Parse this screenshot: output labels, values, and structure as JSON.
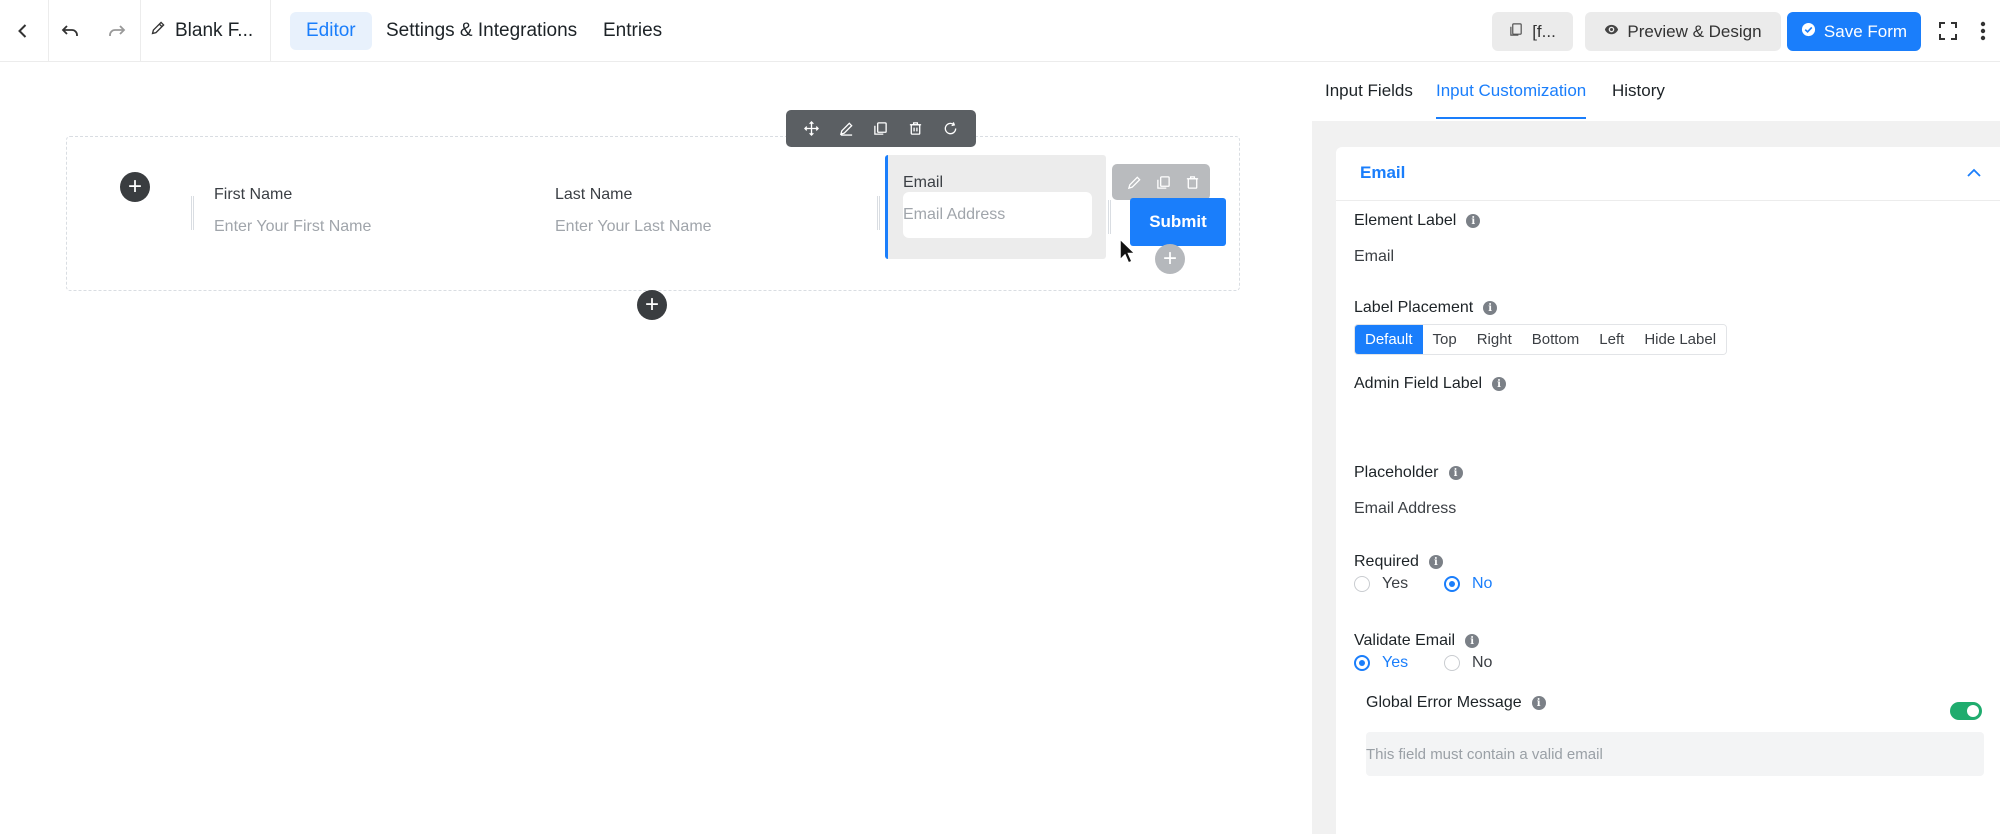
{
  "topbar": {
    "form_name": "Blank F...",
    "tabs": [
      "Editor",
      "Settings & Integrations",
      "Entries"
    ],
    "shortcode_label": "[f...",
    "preview_label": "Preview & Design",
    "save_label": "Save Form"
  },
  "canvas": {
    "fields": {
      "first_name_label": "First Name",
      "first_name_placeholder": "Enter Your First Name",
      "last_name_label": "Last Name",
      "last_name_placeholder": "Enter Your Last Name",
      "email_label": "Email",
      "email_placeholder": "Email Address"
    },
    "submit_label": "Submit"
  },
  "panel": {
    "tabs": [
      "Input Fields",
      "Input Customization",
      "History"
    ],
    "active_tab": "Input Customization",
    "section_title": "Email",
    "element_label": {
      "label": "Element Label",
      "value": "Email"
    },
    "label_placement": {
      "label": "Label Placement",
      "options": [
        "Default",
        "Top",
        "Right",
        "Bottom",
        "Left",
        "Hide Label"
      ],
      "selected": "Default"
    },
    "admin_field_label": {
      "label": "Admin Field Label",
      "value": ""
    },
    "placeholder": {
      "label": "Placeholder",
      "value": "Email Address"
    },
    "required": {
      "label": "Required",
      "options": [
        "Yes",
        "No"
      ],
      "selected": "No"
    },
    "validate_email": {
      "label": "Validate Email",
      "options": [
        "Yes",
        "No"
      ],
      "selected": "Yes"
    },
    "global_error": {
      "label": "Global Error Message",
      "enabled": true,
      "value": "This field must contain a valid email"
    }
  },
  "colors": {
    "accent": "#1a7efb",
    "toggle_on": "#1fac6e"
  },
  "icons": [
    "back-icon",
    "undo-icon",
    "redo-icon",
    "edit-icon",
    "shortcode-icon",
    "eye-icon",
    "check-circle-icon",
    "fullscreen-icon",
    "more-vertical-icon",
    "move-icon",
    "copy-icon",
    "trash-icon",
    "refresh-icon",
    "plus-icon",
    "info-icon",
    "chevron-up-icon"
  ]
}
